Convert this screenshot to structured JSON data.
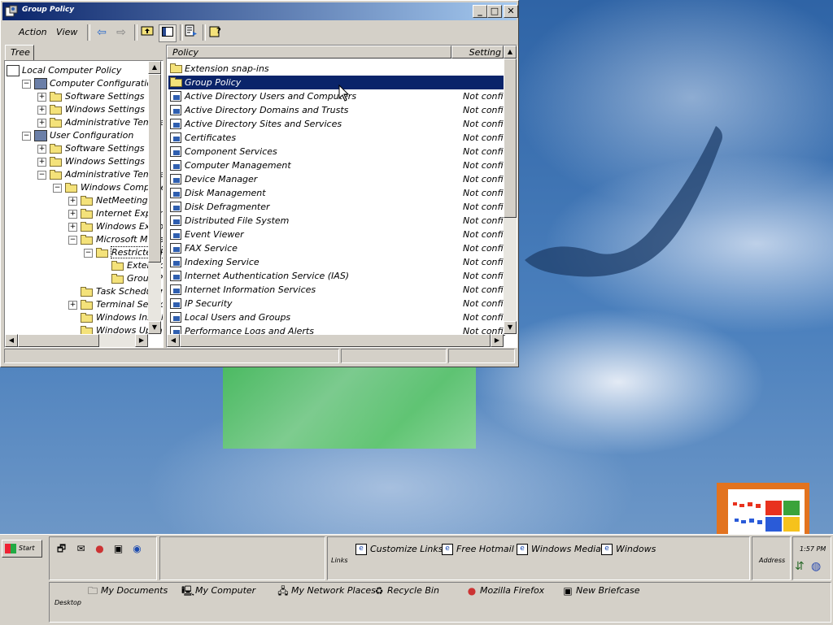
{
  "window": {
    "title": "Group Policy",
    "menu": {
      "action": "Action",
      "view": "View"
    },
    "tree_tab": "Tree",
    "tree_items": [
      {
        "label": "Local Computer Policy",
        "depth": 0,
        "expander": "",
        "icon": "policy-icon"
      },
      {
        "label": "Computer Configuration",
        "depth": 1,
        "expander": "−",
        "icon": "computer-icon"
      },
      {
        "label": "Software Settings",
        "depth": 2,
        "expander": "+",
        "icon": "folder-icon"
      },
      {
        "label": "Windows Settings",
        "depth": 2,
        "expander": "+",
        "icon": "folder-icon"
      },
      {
        "label": "Administrative Templates",
        "depth": 2,
        "expander": "+",
        "icon": "folder-icon"
      },
      {
        "label": "User Configuration",
        "depth": 1,
        "expander": "−",
        "icon": "user-icon"
      },
      {
        "label": "Software Settings",
        "depth": 2,
        "expander": "+",
        "icon": "folder-icon"
      },
      {
        "label": "Windows Settings",
        "depth": 2,
        "expander": "+",
        "icon": "folder-icon"
      },
      {
        "label": "Administrative Templates",
        "depth": 2,
        "expander": "−",
        "icon": "folder-icon"
      },
      {
        "label": "Windows Components",
        "depth": 3,
        "expander": "−",
        "icon": "folder-icon"
      },
      {
        "label": "NetMeeting",
        "depth": 4,
        "expander": "+",
        "icon": "folder-icon"
      },
      {
        "label": "Internet Explorer",
        "depth": 4,
        "expander": "+",
        "icon": "folder-icon"
      },
      {
        "label": "Windows Explorer",
        "depth": 4,
        "expander": "+",
        "icon": "folder-icon"
      },
      {
        "label": "Microsoft Management Console",
        "depth": 4,
        "expander": "−",
        "icon": "folder-icon"
      },
      {
        "label": "Restricted/Permitted snap-ins",
        "depth": 5,
        "expander": "−",
        "icon": "folder-open-icon"
      },
      {
        "label": "Extension snap-ins",
        "depth": 6,
        "expander": "",
        "icon": "folder-icon"
      },
      {
        "label": "Group Policy snap-in extensions",
        "depth": 6,
        "expander": "",
        "icon": "folder-icon"
      },
      {
        "label": "Task Scheduler",
        "depth": 4,
        "expander": "",
        "icon": "folder-icon"
      },
      {
        "label": "Terminal Services",
        "depth": 4,
        "expander": "+",
        "icon": "folder-icon"
      },
      {
        "label": "Windows Installer",
        "depth": 4,
        "expander": "",
        "icon": "folder-icon"
      },
      {
        "label": "Windows Update",
        "depth": 4,
        "expander": "",
        "icon": "folder-icon"
      }
    ],
    "columns": {
      "policy": "Policy",
      "setting": "Setting"
    },
    "list_items": [
      {
        "name": "Extension snap-ins",
        "setting": "",
        "icon": "folder-icon"
      },
      {
        "name": "Group Policy",
        "setting": "",
        "icon": "folder-icon",
        "selected": true
      },
      {
        "name": "Active Directory Users and Computers",
        "setting": "Not configured",
        "icon": "policy-icon"
      },
      {
        "name": "Active Directory Domains and Trusts",
        "setting": "Not configured",
        "icon": "policy-icon"
      },
      {
        "name": "Active Directory Sites and Services",
        "setting": "Not configured",
        "icon": "policy-icon"
      },
      {
        "name": "Certificates",
        "setting": "Not configured",
        "icon": "policy-icon"
      },
      {
        "name": "Component Services",
        "setting": "Not configured",
        "icon": "policy-icon"
      },
      {
        "name": "Computer Management",
        "setting": "Not configured",
        "icon": "policy-icon"
      },
      {
        "name": "Device Manager",
        "setting": "Not configured",
        "icon": "policy-icon"
      },
      {
        "name": "Disk Management",
        "setting": "Not configured",
        "icon": "policy-icon"
      },
      {
        "name": "Disk Defragmenter",
        "setting": "Not configured",
        "icon": "policy-icon"
      },
      {
        "name": "Distributed File System",
        "setting": "Not configured",
        "icon": "policy-icon"
      },
      {
        "name": "Event Viewer",
        "setting": "Not configured",
        "icon": "policy-icon"
      },
      {
        "name": "FAX Service",
        "setting": "Not configured",
        "icon": "policy-icon"
      },
      {
        "name": "Indexing Service",
        "setting": "Not configured",
        "icon": "policy-icon"
      },
      {
        "name": "Internet Authentication Service (IAS)",
        "setting": "Not configured",
        "icon": "policy-icon"
      },
      {
        "name": "Internet Information Services",
        "setting": "Not configured",
        "icon": "policy-icon"
      },
      {
        "name": "IP Security",
        "setting": "Not configured",
        "icon": "policy-icon"
      },
      {
        "name": "Local Users and Groups",
        "setting": "Not configured",
        "icon": "policy-icon"
      },
      {
        "name": "Performance Logs and Alerts",
        "setting": "Not configured",
        "icon": "policy-icon"
      }
    ]
  },
  "taskbar": {
    "start": "Start",
    "links_label": "Links",
    "links": [
      "Customize Links",
      "Free Hotmail",
      "Windows Media",
      "Windows"
    ],
    "address_label": "Address",
    "clock": "1:57 PM",
    "desktop_label": "Desktop",
    "desktop_items": [
      {
        "label": "My Documents",
        "icon": "documents-icon"
      },
      {
        "label": "My Computer",
        "icon": "computer-icon"
      },
      {
        "label": "My Network Places",
        "icon": "network-icon"
      },
      {
        "label": "Recycle Bin",
        "icon": "recycle-bin-icon"
      },
      {
        "label": "Mozilla Firefox",
        "icon": "firefox-icon"
      },
      {
        "label": "New Briefcase",
        "icon": "briefcase-icon"
      }
    ]
  },
  "colors": {
    "title_start": "#0a246a",
    "title_end": "#a6caf0",
    "selection": "#0a246a",
    "face": "#d4d0c8"
  }
}
